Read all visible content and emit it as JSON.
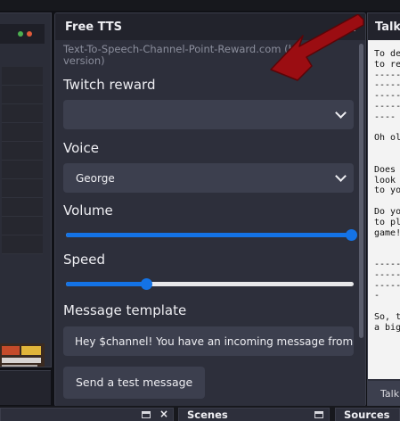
{
  "tts_dock": {
    "title": "Free TTS",
    "description_line1": "Text-To-Speech-Channel-Point-Reward.com (beta",
    "description_line2": "version)",
    "twitch_reward_label": "Twitch reward",
    "twitch_reward_value": "",
    "voice_label": "Voice",
    "voice_value": "George",
    "volume_label": "Volume",
    "volume_level": 0.99,
    "speed_label": "Speed",
    "speed_level": 0.28,
    "message_template_label": "Message template",
    "message_template_value": "Hey $channel! You have an incoming message from $u",
    "test_button_label": "Send a test message"
  },
  "talking_panel": {
    "title": "Talki",
    "log_lines": [
      "To de",
      "to re",
      "-----",
      "-----",
      "-----",
      "-----",
      "---- ",
      "",
      "Oh ol",
      "",
      "",
      "Does ",
      "look ",
      "to yo",
      "",
      "Do yo",
      "to pl",
      "game!",
      "",
      "",
      "-----",
      "-----",
      "-----",
      "-",
      "",
      "So, t",
      "a big"
    ],
    "footer_text": "Talki"
  },
  "bottom_tabs": {
    "first_label": "",
    "scenes_label": "Scenes",
    "sources_label": "Sources",
    "close_glyph": "×"
  },
  "colors": {
    "accent": "#1473e6",
    "arrow": "#9b0d12",
    "panel_bg": "#2d2f3b",
    "input_bg": "#3c3f4e"
  }
}
